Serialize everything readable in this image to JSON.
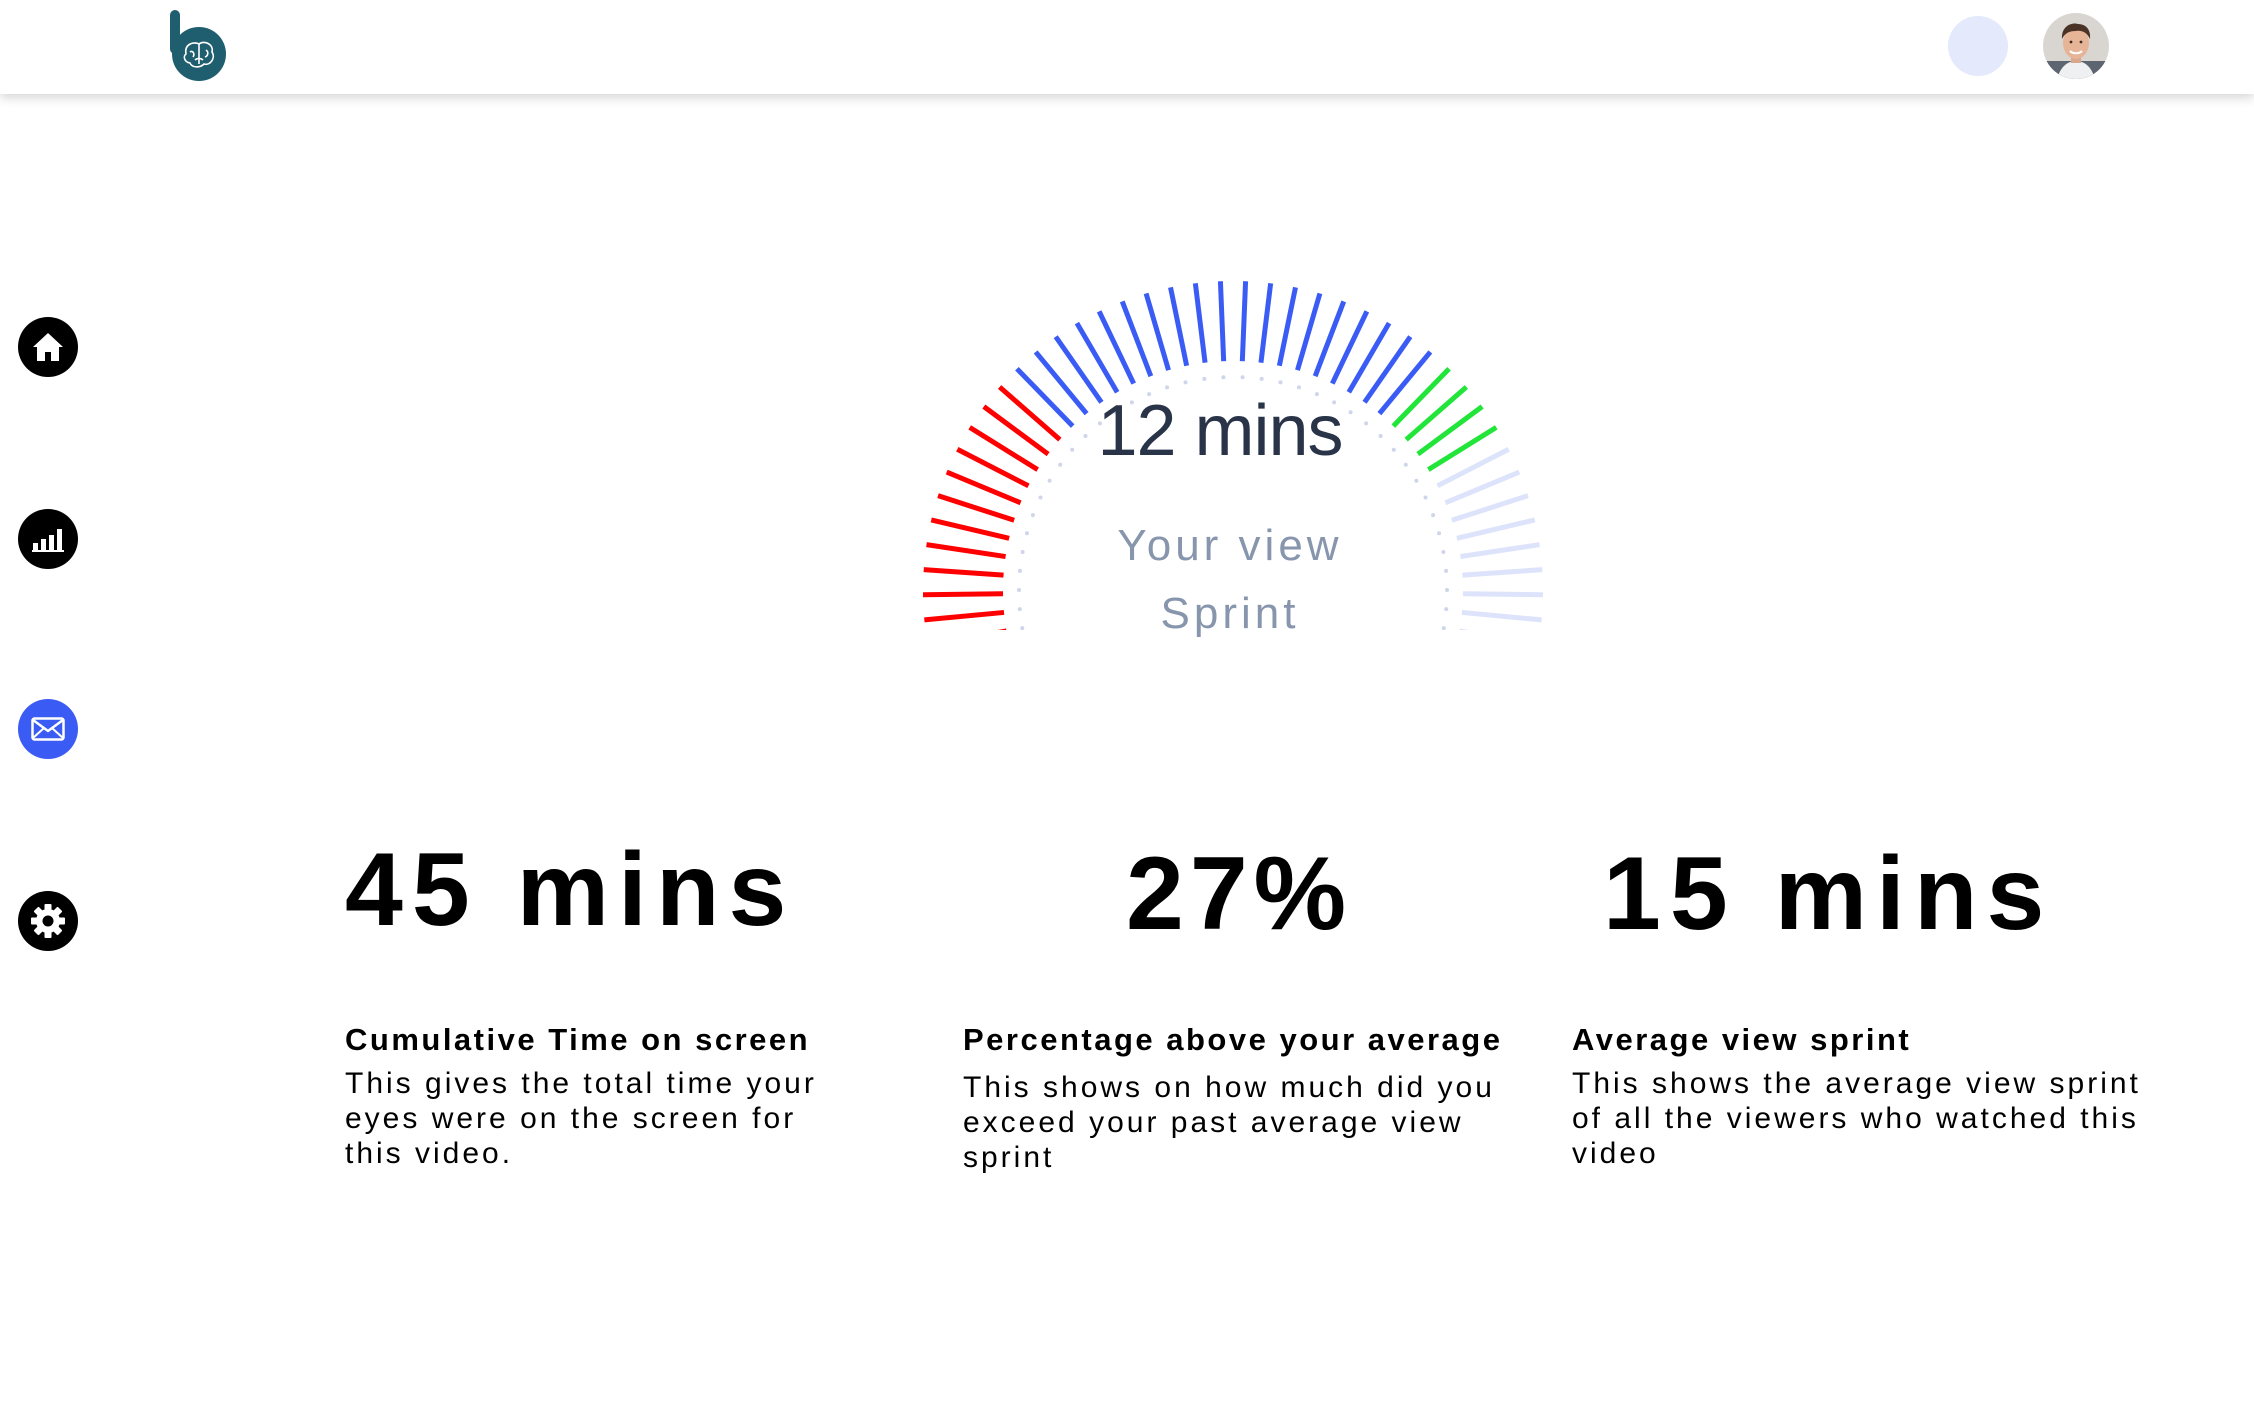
{
  "gauge": {
    "value_text": "12 mins",
    "label_line1": "Your view",
    "label_line2": "Sprint",
    "ticks_total": 44,
    "segments": [
      {
        "name": "red",
        "count": 12,
        "color": "#ff0000"
      },
      {
        "name": "blue",
        "count": 19,
        "color": "#3a5cf5"
      },
      {
        "name": "green",
        "count": 4,
        "color": "#22e53a"
      },
      {
        "name": "light",
        "count": 9,
        "color": "#dde3fb"
      }
    ],
    "inner_dot_color": "#cfd5ea"
  },
  "stats": [
    {
      "value": "45 mins",
      "title": "Cumulative Time on screen",
      "desc": [
        "This gives the total time your",
        "eyes were on the screen for",
        "this video."
      ]
    },
    {
      "value": "27%",
      "title": "Percentage above your average",
      "desc": [
        "This shows on how much did you",
        "exceed your past average view",
        "sprint"
      ]
    },
    {
      "value": "15 mins",
      "title": "Average view sprint",
      "desc": [
        "This shows the average view sprint",
        "of all the viewers who watched this",
        "video"
      ]
    }
  ],
  "sidebar": {
    "items": [
      {
        "icon": "home-icon"
      },
      {
        "icon": "bar-chart-icon"
      },
      {
        "icon": "mail-icon",
        "active": true
      },
      {
        "icon": "gear-icon"
      }
    ]
  },
  "colors": {
    "accent": "#3a5cf5",
    "logo": "#1f5e6e"
  }
}
